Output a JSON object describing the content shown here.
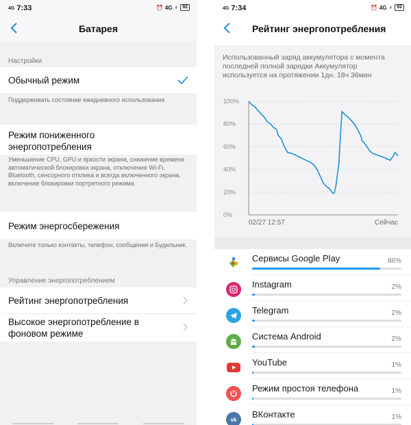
{
  "left": {
    "status": {
      "time": "7:33",
      "net": "4G",
      "net2": "4G",
      "battery": "92"
    },
    "header": {
      "title": "Батарея"
    },
    "sections": {
      "settings": "Настройки",
      "power_mgmt": "Управление энергопотреблением"
    },
    "modes": [
      {
        "title": "Обычный режим",
        "desc": "Поддерживать состояние ежедневного использования",
        "selected": true
      },
      {
        "title": "Режим пониженного энергопотребления",
        "desc": "Уменьшение CPU, GPU и яркости экрана, снижение времени автоматической блокировки экрана, отключение Wi-Fi, Bluetooth, сенсорного отклика и всегда включенного экрана, включение блокировки портретного режима."
      },
      {
        "title": "Режим энергосбережения",
        "desc": "Включите только контакты, телефон, сообщения и Будильник."
      }
    ],
    "menu": [
      {
        "title": "Рейтинг энергопотребления"
      },
      {
        "title": "Высокое энергопотребление в фоновом режиме"
      }
    ]
  },
  "right": {
    "status": {
      "time": "7:34",
      "net": "4G",
      "net2": "4G",
      "battery": "92"
    },
    "header": {
      "title": "Рейтинг энергопотребления"
    },
    "caption": "Использованный заряд аккумулятора с момента последней полной зарядки Аккумулятор используется на протяжении 1дн. 18ч 36мин",
    "chart_data": {
      "type": "line",
      "y_ticks": [
        "100%",
        "80%",
        "60%",
        "40%",
        "20%",
        "0%"
      ],
      "ylim": [
        0,
        100
      ],
      "x_start_label": "02/27 12:57",
      "x_end_label": "Сейчас",
      "grid": true,
      "series_color": "#1e90d6",
      "points": [
        [
          0,
          100
        ],
        [
          2,
          97
        ],
        [
          4,
          95
        ],
        [
          6,
          92
        ],
        [
          8,
          89
        ],
        [
          10,
          86
        ],
        [
          12,
          82
        ],
        [
          14,
          80
        ],
        [
          16,
          77
        ],
        [
          18,
          75
        ],
        [
          19,
          70
        ],
        [
          21,
          67
        ],
        [
          23,
          60
        ],
        [
          25,
          55
        ],
        [
          28,
          54
        ],
        [
          31,
          52
        ],
        [
          34,
          50
        ],
        [
          37,
          48
        ],
        [
          40,
          46
        ],
        [
          42,
          44
        ],
        [
          44,
          40
        ],
        [
          46,
          34
        ],
        [
          48,
          28
        ],
        [
          50,
          25
        ],
        [
          52,
          23
        ],
        [
          53,
          21
        ],
        [
          54,
          19
        ],
        [
          55,
          19
        ],
        [
          56,
          25
        ],
        [
          58,
          45
        ],
        [
          59,
          70
        ],
        [
          60,
          91
        ],
        [
          62,
          88
        ],
        [
          64,
          86
        ],
        [
          66,
          83
        ],
        [
          68,
          80
        ],
        [
          70,
          75
        ],
        [
          72,
          70
        ],
        [
          73,
          65
        ],
        [
          74,
          64
        ],
        [
          75,
          62
        ],
        [
          76,
          60
        ],
        [
          78,
          56
        ],
        [
          80,
          54
        ],
        [
          82,
          53
        ],
        [
          84,
          52
        ],
        [
          86,
          51
        ],
        [
          88,
          50
        ],
        [
          89,
          49
        ],
        [
          90,
          49
        ],
        [
          91,
          48
        ],
        [
          92,
          50
        ],
        [
          93,
          52
        ],
        [
          94,
          55
        ],
        [
          95,
          54
        ],
        [
          96,
          52
        ]
      ]
    },
    "apps": [
      {
        "name": "Сервисы Google Play",
        "pct": "86%",
        "fraction": 0.86,
        "icon": "google-play-services-icon",
        "color": "#ffffff"
      },
      {
        "name": "Instagram",
        "pct": "2%",
        "fraction": 0.02,
        "icon": "instagram-icon",
        "color": "#d6276f"
      },
      {
        "name": "Telegram",
        "pct": "2%",
        "fraction": 0.02,
        "icon": "telegram-icon",
        "color": "#2aa3df"
      },
      {
        "name": "Система Android",
        "pct": "2%",
        "fraction": 0.02,
        "icon": "android-icon",
        "color": "#5fae47"
      },
      {
        "name": "YouTube",
        "pct": "1%",
        "fraction": 0.01,
        "icon": "youtube-icon",
        "color": "#ffffff"
      },
      {
        "name": "Режим простоя телефона",
        "pct": "1%",
        "fraction": 0.01,
        "icon": "power-icon",
        "color": "#ef5350"
      },
      {
        "name": "ВКонтакте",
        "pct": "1%",
        "fraction": 0.01,
        "icon": "vk-icon",
        "color": "#4a76a8"
      }
    ]
  }
}
